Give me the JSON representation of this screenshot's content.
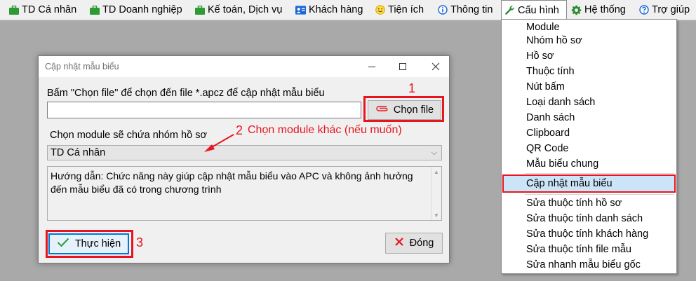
{
  "menubar": {
    "items": [
      {
        "label": "TD Cá nhân",
        "icon": "briefcase-icon"
      },
      {
        "label": "TD Doanh nghiệp",
        "icon": "briefcase-icon"
      },
      {
        "label": "Kế toán, Dịch vụ",
        "icon": "briefcase-icon"
      },
      {
        "label": "Khách hàng",
        "icon": "contact-card-icon"
      },
      {
        "label": "Tiện ích",
        "icon": "smiley-icon"
      },
      {
        "label": "Thông tin",
        "icon": "info-icon"
      },
      {
        "label": "Cấu hình",
        "icon": "wrench-icon"
      },
      {
        "label": "Hệ thống",
        "icon": "gear-icon"
      },
      {
        "label": "Trợ giúp",
        "icon": "help-icon"
      }
    ]
  },
  "dropdown": {
    "items": [
      "Module",
      "Nhóm hồ sơ",
      "Hồ sơ",
      "Thuộc tính",
      "Nút bấm",
      "Loại danh sách",
      "Danh sách",
      "Clipboard",
      "QR Code",
      "Mẫu biểu chung",
      "Cập nhật mẫu biểu",
      "Sửa thuộc tính hồ sơ",
      "Sửa thuộc tính danh sách",
      "Sửa thuộc tính khách hàng",
      "Sửa thuộc tính file mẫu",
      "Sửa nhanh mẫu biểu gốc"
    ],
    "highlighted": "Cập nhật mẫu biểu"
  },
  "dialog": {
    "title": "Cập nhật mẫu biểu",
    "file_label": "Bấm \"Chọn file\" để chọn đến file *.apcz để cập nhật mẫu biểu",
    "file_value": "",
    "choose_button": "Chọn file",
    "module_label": "Chọn module sẽ chứa nhóm hồ sơ",
    "module_selected": "TD Cá nhân",
    "guide_text": "Hướng dẫn: Chức năng này giúp cập nhật mẫu  biểu vào APC và không ảnh hưởng đến mẫu biểu đã có trong chương trình",
    "run_button": "Thực hiện",
    "close_button": "Đóng"
  },
  "annotations": {
    "step1": "1",
    "step2": "2",
    "step2_text": "Chọn module khác (nếu muốn)",
    "step3": "3"
  },
  "colors": {
    "annotation_red": "#e8151e",
    "highlight_blue": "#cce4f7",
    "focus_blue": "#0078d7",
    "briefcase_green": "#2e9a35",
    "info_blue": "#1a66d6"
  }
}
